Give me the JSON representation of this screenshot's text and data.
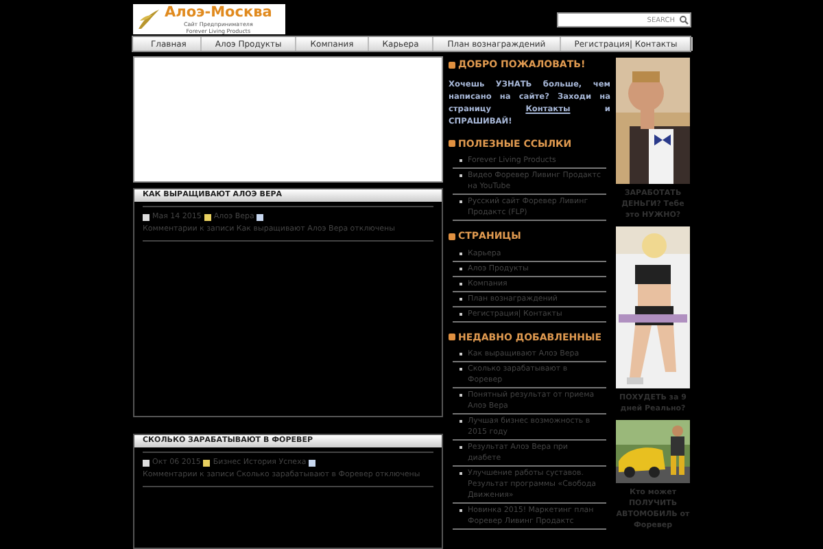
{
  "logo": {
    "title": "Алоэ-Москва",
    "subtitle": "Сайт Предпринимателя Forever Living Products"
  },
  "search": {
    "placeholder": "SEARCH"
  },
  "nav": [
    "Главная",
    "Алоэ Продукты",
    "Компания",
    "Карьера",
    "План вознаграждений",
    "Регистрация| Контакты"
  ],
  "posts": [
    {
      "title": "КАК ВЫРАЩИВАЮТ АЛОЭ ВЕРА",
      "date": "Мая 14 2015",
      "category": "Алоэ Вера",
      "comments": "Комментарии к записи Как выращивают Алоэ Вера отключены"
    },
    {
      "title": "СКОЛЬКО ЗАРАБАТЫВАЮТ В ФОРЕВЕР",
      "date": "Окт 06 2015",
      "category": "Бизнес История Успеха",
      "comments": "Комментарии к записи Сколько зарабатывают в Форевер отключены"
    }
  ],
  "sidebar": [
    {
      "kind": "text",
      "title": "ДОБРО ПОЖАЛОВАТЬ!",
      "text": "Хочешь УЗНАТЬ больше, чем написано на сайте? Заходи на страницу",
      "link": "Контакты",
      "text_after": "и СПРАШИВАЙ!"
    },
    {
      "kind": "list",
      "title": "ПОЛЕЗНЫЕ ССЫЛКИ",
      "items": [
        "Forever Living Products",
        "Видео Форевер Ливинг Продактс на YouTube",
        "Русский сайт Форевер Ливинг Продактс (FLP)"
      ]
    },
    {
      "kind": "list",
      "title": "СТРАНИЦЫ",
      "items": [
        "Карьера",
        "Алоэ Продукты",
        "Компания",
        "План вознаграждений",
        "Регистрация| Контакты"
      ]
    },
    {
      "kind": "list",
      "title": "НЕДАВНО ДОБАВЛЕННЫЕ",
      "items": [
        "Как выращивают Алоэ Вера",
        "Сколько зарабатывают в Форевер",
        "Понятный результат от приема Алоэ Вера",
        "Лучшая бизнес возможность в 2015 году",
        "Результат Алоэ Вера при диабете",
        "Улучшение работы суставов. Результат программы «Свобода Движения»",
        "Новинка 2015! Маркетинг план Форевер Ливинг Продактс"
      ]
    }
  ],
  "promos": [
    {
      "kind": "picture",
      "caption": "ЗАРАБОТАТЬ ДЕНЬГИ? Тебе это НУЖНО?"
    },
    {
      "kind": "picture",
      "caption": "ПОХУДЕТЬ за 9 дней Реально?"
    },
    {
      "kind": "picture",
      "caption": "Кто может ПОЛУЧИТЬ АВТОМОБИЛЬ от Форевер"
    }
  ]
}
